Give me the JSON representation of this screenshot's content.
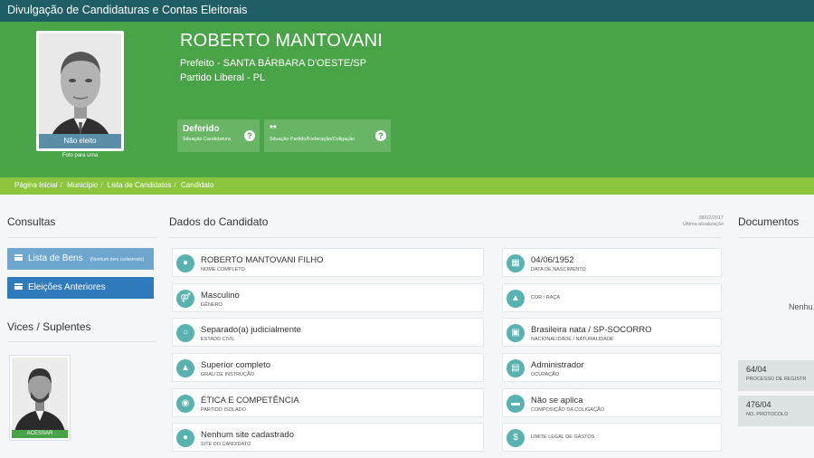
{
  "site_title": "Divulgação de Candidaturas e Contas Eleitorais",
  "candidate": {
    "name": "ROBERTO MANTOVANI",
    "office": "Prefeito - SANTA BÁRBARA D'OESTE/SP",
    "party": "Partido Liberal - PL",
    "photo_status": "Não eleito",
    "photo_caption": "Foto para urna"
  },
  "status_boxes": [
    {
      "value": "Deferido",
      "label": "Situação Candidatura"
    },
    {
      "value": "**",
      "label": "Situação Partido/Federação/Coligação"
    }
  ],
  "breadcrumb": [
    "Página Inicial",
    "Município",
    "Lista de Candidatos",
    "Candidato"
  ],
  "sidebar": {
    "consultas_title": "Consultas",
    "lista_bens": "Lista de Bens",
    "lista_bens_note": "(Nenhum bem cadastrado)",
    "eleicoes_anteriores": "Eleições Anteriores",
    "vices_title": "Vices / Suplentes",
    "vice_action": "ACESSAR"
  },
  "main": {
    "title": "Dados do Candidato",
    "update_date": "08/02/2017",
    "update_label": "Última atualização",
    "fields_left": [
      {
        "value": "ROBERTO MANTOVANI FILHO",
        "label": "NOME COMPLETO",
        "icon": "person-icon"
      },
      {
        "value": "Masculino",
        "label": "GÊNERO",
        "icon": "gender-icon"
      },
      {
        "value": "Separado(a) judicialmente",
        "label": "ESTADO CIVIL",
        "icon": "ring-icon"
      },
      {
        "value": "Superior completo",
        "label": "GRAU DE INSTRUÇÃO",
        "icon": "education-icon"
      },
      {
        "value": "ÉTICA E COMPETÊNCIA",
        "label": "PARTIDO ISOLADO",
        "icon": "group-icon"
      },
      {
        "value": "Nenhum site cadastrado",
        "label": "SITE DO CANDIDATO",
        "icon": "globe-icon"
      }
    ],
    "fields_right": [
      {
        "value": "04/06/1952",
        "label": "DATA DE NASCIMENTO",
        "icon": "calendar-icon"
      },
      {
        "value": "",
        "label": "COR / RAÇA",
        "icon": "shirt-icon"
      },
      {
        "value": "Brasileira nata / SP-SOCORRO",
        "label": "NACIONALIDADE / NATURALIDADE",
        "icon": "map-icon"
      },
      {
        "value": "Administrador",
        "label": "OCUPAÇÃO",
        "icon": "building-icon"
      },
      {
        "value": "Não se aplica",
        "label": "COMPOSIÇÃO DA COLIGAÇÃO",
        "icon": "folder-icon"
      },
      {
        "value": "",
        "label": "LIMITE LEGAL DE GASTOS",
        "icon": "dollar-icon"
      }
    ]
  },
  "documents": {
    "title": "Documentos",
    "empty_text": "Nenhu",
    "items": [
      {
        "value": "64/04",
        "label": "PROCESSO DE REGISTRO DE"
      },
      {
        "value": "476/04",
        "label": "NO. PROTOCOLO"
      }
    ]
  }
}
